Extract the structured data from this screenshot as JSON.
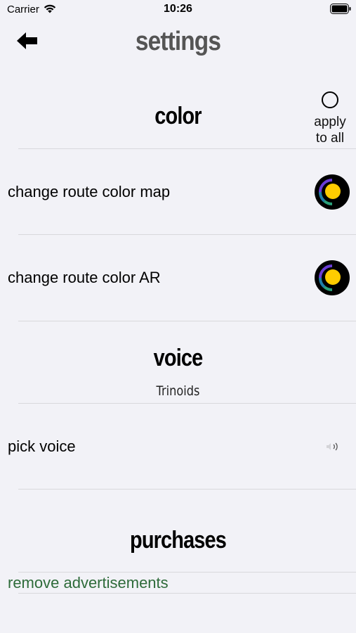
{
  "status_bar": {
    "carrier": "Carrier",
    "time": "10:26",
    "icons": [
      "wifi-icon",
      "battery-icon"
    ]
  },
  "header": {
    "title": "settings",
    "back_icon": "arrow-left-icon"
  },
  "sections": {
    "color": {
      "heading": "color",
      "apply_to_all_label_line1": "apply",
      "apply_to_all_label_line2": "to all",
      "apply_to_all_checked": false,
      "rows": [
        {
          "label": "change route color map",
          "swatch_color": "#ffcc00"
        },
        {
          "label": "change route color AR",
          "swatch_color": "#ffcc00"
        }
      ]
    },
    "voice": {
      "heading": "voice",
      "current_voice": "Trinoids",
      "rows": [
        {
          "label": "pick voice",
          "icon": "speaker-icon"
        }
      ]
    },
    "purchases": {
      "heading": "purchases",
      "rows": [
        {
          "label": "remove advertisements",
          "color": "#2e6b3a"
        }
      ]
    }
  },
  "colors": {
    "background": "#f2f2f7",
    "separator": "#d8d8dc",
    "link_green": "#2e6b3a",
    "swatch_yellow": "#ffcc00"
  }
}
